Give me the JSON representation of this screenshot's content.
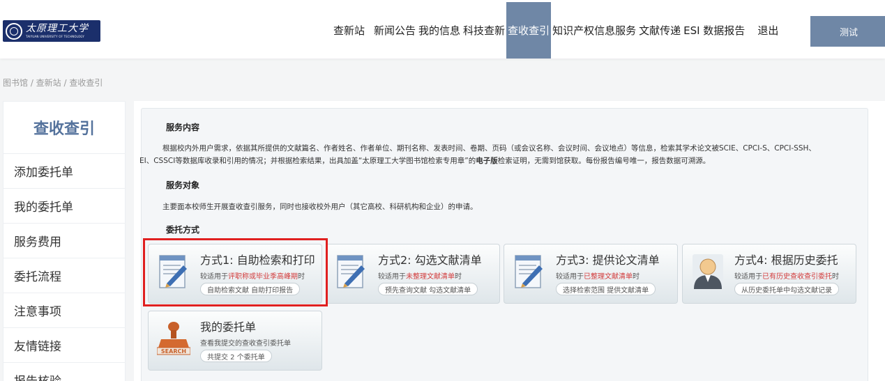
{
  "header": {
    "logo_cn": "太原理工大学",
    "logo_en": "TAIYUAN UNIVERSITY OF TECHNOLOGY",
    "nav": [
      "查新站",
      "新闻公告",
      "我的信息",
      "科技查新",
      "查收查引",
      "知识产权信息服务",
      "文献传递",
      "ESI 数据报告",
      "退出"
    ],
    "active_nav": "查收查引",
    "test_label": "测试",
    "accent_color": "#6f87a6"
  },
  "breadcrumb": "图书馆 / 查新站 / 查收查引",
  "sidebar": {
    "title": "查收查引",
    "items": [
      "添加委托单",
      "我的委托单",
      "服务费用",
      "委托流程",
      "注意事项",
      "友情链接",
      "报告核验"
    ]
  },
  "content": {
    "service_title": "服务内容",
    "service_text_1": "根据校内外用户需求，依据其所提供的文献篇名、作者姓名、作者单位、期刊名称、发表时间、卷期、页码（或会议名称、会议时间、会议地点）等信息，检索其学术论文被SCIE、CPCI-S、CPCI-SSH、",
    "service_text_2a": "EI、CSSCI等数据库收录和引用的情况；并根据检索结果，出具加盖“太原理工大学图书馆检索专用章”的",
    "service_text_2b": "电子版",
    "service_text_2c": "检索证明，无需到馆获取。每份报告编号唯一，报告数据可溯源。",
    "target_title": "服务对象",
    "target_text": "主要面本校师生开展查收查引服务，同时也接收校外用户（其它高校、科研机构和企业）的申请。",
    "method_title": "委托方式"
  },
  "cards": [
    {
      "title": "方式1: 自助检索和打印",
      "desc_pre": "较适用于",
      "desc_hl": "评职称或毕业季高峰期",
      "desc_post": "时",
      "tag": "自助检索文献 自助打印报告",
      "icon": "document-pen-icon"
    },
    {
      "title": "方式2: 勾选文献清单",
      "desc_pre": "较适用于",
      "desc_hl": "未整理文献清单",
      "desc_post": "时",
      "tag": "预先查询文献 勾选文献清单",
      "icon": "document-pen-icon"
    },
    {
      "title": "方式3: 提供论文清单",
      "desc_pre": "较适用于",
      "desc_hl": "已整理文献清单",
      "desc_post": "时",
      "tag": "选择检索范围 提供文献清单",
      "icon": "document-pen-icon"
    },
    {
      "title": "方式4: 根据历史委托",
      "desc_pre": "较适用于",
      "desc_hl": "已有历史查收查引委托",
      "desc_post": "时",
      "tag": "从历史委托单中勾选文献记录",
      "icon": "user-avatar-icon"
    },
    {
      "title": "我的委托单",
      "desc_pre": "查看我提交的查收查引委托单",
      "desc_hl": "",
      "desc_post": "",
      "tag": "共提交 2 个委托单",
      "icon": "search-stamp-icon",
      "stamp_label": "SEARCH"
    }
  ]
}
